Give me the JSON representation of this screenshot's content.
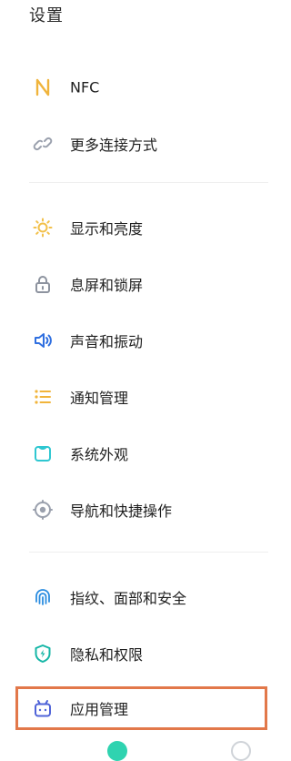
{
  "page": {
    "title": "设置"
  },
  "groups": [
    {
      "items": [
        {
          "id": "nfc",
          "label": "NFC",
          "icon": "nfc-icon"
        },
        {
          "id": "more-connections",
          "label": "更多连接方式",
          "icon": "link-icon"
        }
      ]
    },
    {
      "items": [
        {
          "id": "display",
          "label": "显示和亮度",
          "icon": "brightness-icon"
        },
        {
          "id": "lock-screen",
          "label": "息屏和锁屏",
          "icon": "lock-icon"
        },
        {
          "id": "sound",
          "label": "声音和振动",
          "icon": "speaker-icon"
        },
        {
          "id": "notifications",
          "label": "通知管理",
          "icon": "list-icon"
        },
        {
          "id": "appearance",
          "label": "系统外观",
          "icon": "theme-icon"
        },
        {
          "id": "navigation",
          "label": "导航和快捷操作",
          "icon": "navigation-icon"
        }
      ]
    },
    {
      "items": [
        {
          "id": "security",
          "label": "指纹、面部和安全",
          "icon": "fingerprint-icon"
        },
        {
          "id": "privacy",
          "label": "隐私和权限",
          "icon": "shield-icon"
        },
        {
          "id": "app-management",
          "label": "应用管理",
          "icon": "app-icon"
        }
      ]
    }
  ],
  "colors": {
    "highlight": "#e2784a",
    "nfc": "#f0b43c",
    "link": "#9aa0ad",
    "brightness": "#f2c04a",
    "lock": "#8d939f",
    "speaker": "#2f6fe0",
    "list": "#f1b43b",
    "theme": "#2fc7d1",
    "navigation": "#9aa0ad",
    "fingerprint": "#2a8ce0",
    "shield": "#15b6a6",
    "app": "#4f63d8"
  }
}
